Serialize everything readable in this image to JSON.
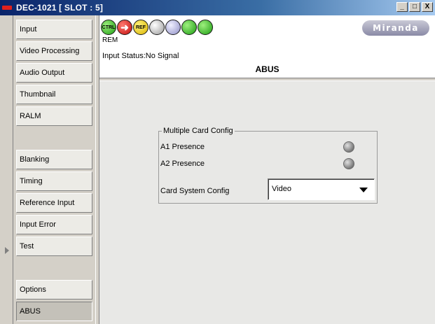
{
  "window": {
    "title": "DEC-1021 [ SLOT : 5]",
    "minimize": "_",
    "maximize": "□",
    "close": "X"
  },
  "sidebar": {
    "items": [
      {
        "label": "Input",
        "active": false
      },
      {
        "label": "Video Processing",
        "active": false
      },
      {
        "label": "Audio Output",
        "active": false
      },
      {
        "label": "Thumbnail",
        "active": false
      },
      {
        "label": "RALM",
        "active": false
      },
      {
        "label": "",
        "active": false
      },
      {
        "label": "Blanking",
        "active": false
      },
      {
        "label": "Timing",
        "active": false
      },
      {
        "label": "Reference Input",
        "active": false
      },
      {
        "label": "Input Error",
        "active": false
      },
      {
        "label": "Test",
        "active": false
      },
      {
        "label": "",
        "active": false
      },
      {
        "label": "Options",
        "active": false
      },
      {
        "label": "ABUS",
        "active": true
      }
    ]
  },
  "toolbar": {
    "icons": [
      {
        "name": "ctrl-icon",
        "text": "CTRL",
        "color": "#1c9c12"
      },
      {
        "name": "input-arrow-icon",
        "text": "➜",
        "color": "#c00c0c"
      },
      {
        "name": "ref-icon",
        "text": "REF",
        "color": "#d9b300"
      },
      {
        "name": "video-icon",
        "text": "",
        "color": "#9a9a9a"
      },
      {
        "name": "audio-icon",
        "text": "",
        "color": "#8e8ec6"
      },
      {
        "name": "loop-icon",
        "text": "",
        "color": "#1c9c12"
      },
      {
        "name": "copy-icon",
        "text": "",
        "color": "#1c9c12"
      }
    ],
    "rem_label": "REM",
    "logo": "Miranda"
  },
  "status": {
    "input_status": "Input Status:No Signal",
    "panel_title": "ABUS"
  },
  "group": {
    "legend": "Multiple Card Config",
    "a1_label": "A1 Presence",
    "a2_label": "A2 Presence",
    "config_label": "Card System Config",
    "config_value": "Video"
  }
}
